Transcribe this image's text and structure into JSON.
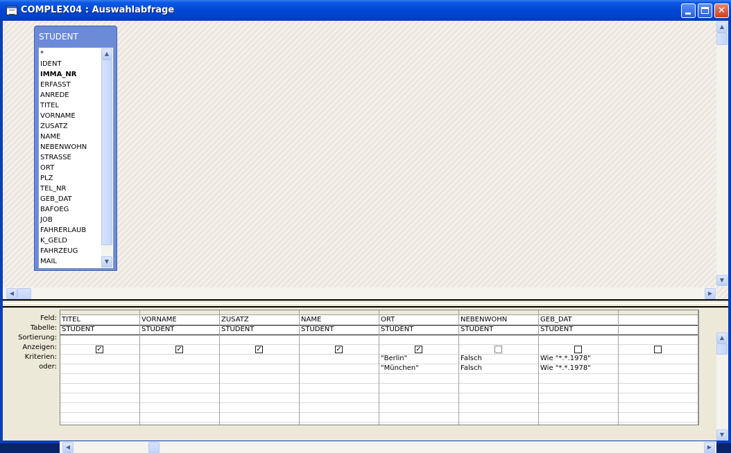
{
  "window": {
    "title": "COMPLEX04 : Auswahlabfrage"
  },
  "field_list": {
    "table_name": "STUDENT",
    "primary_key": "IMMA_NR",
    "fields": [
      "*",
      "IDENT",
      "IMMA_NR",
      "ERFASST",
      "ANREDE",
      "TITEL",
      "VORNAME",
      "ZUSATZ",
      "NAME",
      "NEBENWOHN",
      "STRASSE",
      "ORT",
      "PLZ",
      "TEL_NR",
      "GEB_DAT",
      "BAFOEG",
      "JOB",
      "FAHRERLAUB",
      "K_GELD",
      "FAHRZEUG",
      "MAIL"
    ]
  },
  "grid": {
    "row_labels": [
      "Feld:",
      "Tabelle:",
      "Sortierung:",
      "Anzeigen:",
      "Kriterien:",
      "oder:"
    ],
    "columns": [
      {
        "field": "TITEL",
        "table": "STUDENT",
        "sort": "",
        "show": true,
        "criteria": "",
        "or": ""
      },
      {
        "field": "VORNAME",
        "table": "STUDENT",
        "sort": "",
        "show": true,
        "criteria": "",
        "or": ""
      },
      {
        "field": "ZUSATZ",
        "table": "STUDENT",
        "sort": "",
        "show": true,
        "criteria": "",
        "or": ""
      },
      {
        "field": "NAME",
        "table": "STUDENT",
        "sort": "",
        "show": true,
        "criteria": "",
        "or": ""
      },
      {
        "field": "ORT",
        "table": "STUDENT",
        "sort": "",
        "show": true,
        "criteria": "\"Berlin\"",
        "or": "\"München\""
      },
      {
        "field": "NEBENWOHN",
        "table": "STUDENT",
        "sort": "",
        "show": false,
        "criteria": "Falsch",
        "or": "Falsch"
      },
      {
        "field": "GEB_DAT",
        "table": "STUDENT",
        "sort": "",
        "show": false,
        "criteria": "Wie \"*.*.1978\"",
        "or": "Wie \"*.*.1978\""
      },
      {
        "field": "",
        "table": "",
        "sort": "",
        "show": false,
        "criteria": "",
        "or": ""
      }
    ]
  },
  "icons": {
    "scroll_up": "▲",
    "scroll_down": "▼",
    "scroll_left": "◀",
    "scroll_right": "▶",
    "check": "✓"
  }
}
